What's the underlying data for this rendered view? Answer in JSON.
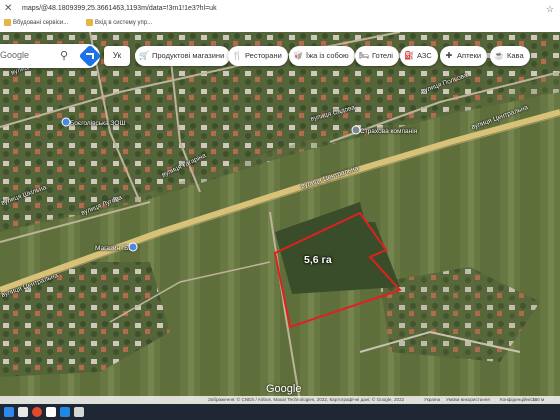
{
  "browser": {
    "url": "maps/@48.1809399,25.3661463,1193m/data=!3m1!1e3?hl=uk",
    "bookmarks": [
      "Вбудовані сервіси...",
      "Вхід в систему упр..."
    ]
  },
  "search": {
    "placeholder": "Google"
  },
  "language_button": "Ук",
  "chips": [
    {
      "label": "Продуктові магазини",
      "icon": "cart-icon"
    },
    {
      "label": "Ресторани",
      "icon": "fork-knife-icon"
    },
    {
      "label": "Їжа із собою",
      "icon": "takeout-icon"
    },
    {
      "label": "Готелі",
      "icon": "bed-icon"
    },
    {
      "label": "АЗС",
      "icon": "fuel-icon"
    },
    {
      "label": "Аптеки",
      "icon": "pharmacy-icon"
    },
    {
      "label": "Кава",
      "icon": "coffee-icon"
    }
  ],
  "map": {
    "labels": {
      "school": "Боєголівська ЗОШ",
      "company": "Страхова компанія",
      "store": "Магазин \"Бар\"",
      "street_central_1": "вулиця Центральна",
      "street_central_2": "вулиця Центральна",
      "street_central_3": "вулиця Центральна",
      "street_1": "вулиця Садова",
      "street_2": "вулиця Лугова",
      "street_3": "вулиця Садова",
      "street_4": "вулиця Польова",
      "street_5": "вулиця Гагаріна",
      "street_6": "вулиця Шкільна"
    },
    "area_label": "5,6 га",
    "google": "Google"
  },
  "attribution": {
    "imagery": "Зображення: © CNES / Airbus, Maxar Technologies, 2022, Картографічні дані: © Google, 2022",
    "country": "Україна",
    "terms": "Умови використання",
    "privacy": "Конфіденційність",
    "feedback": "Надіслати відгук",
    "scale": "100 м"
  },
  "colors": {
    "accent": "#1a73e8",
    "area_outline": "#e02020",
    "road": "#d8c27a",
    "taskbar": "#1e2733"
  }
}
